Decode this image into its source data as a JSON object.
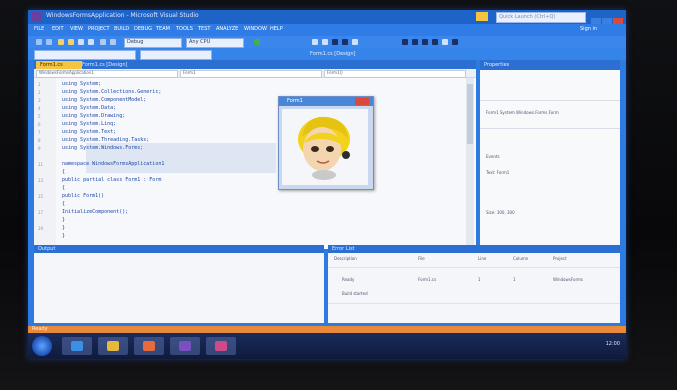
{
  "window": {
    "title": "WindowsFormsApplication - Microsoft Visual Studio",
    "quick_launch_placeholder": "Quick Launch (Ctrl+Q)",
    "user": "Sign in"
  },
  "menu": [
    "FILE",
    "EDIT",
    "VIEW",
    "PROJECT",
    "BUILD",
    "DEBUG",
    "TEAM",
    "TOOLS",
    "TEST",
    "ANALYZE",
    "WINDOW",
    "HELP"
  ],
  "toolbar": {
    "config": "Debug",
    "platform": "Any CPU",
    "secondary_label": "Form1.cs [Design]"
  },
  "editor": {
    "tabs": [
      "Form1.cs",
      "Form1.cs [Design]"
    ],
    "nav": [
      "WindowsFormsApplication1",
      "Form1",
      "Form1()"
    ],
    "lines": [
      "using System;",
      "using System.Collections.Generic;",
      "using System.ComponentModel;",
      "using System.Data;",
      "using System.Drawing;",
      "using System.Linq;",
      "using System.Text;",
      "using System.Threading.Tasks;",
      "using System.Windows.Forms;",
      "",
      "namespace WindowsFormsApplication1",
      "{",
      "    public partial class Form1 : Form",
      "    {",
      "        public Form1()",
      "        {",
      "            InitializeComponent();",
      "        }",
      "    }",
      "}"
    ]
  },
  "form_window": {
    "title": "Form1"
  },
  "properties": {
    "title": "Properties",
    "rows": [
      "Form1 System.Windows.Forms.Form",
      "Events",
      "Text: Form1",
      "Size: 300, 300"
    ]
  },
  "bottom_left": {
    "title": "Output"
  },
  "bottom_right": {
    "title": "Error List",
    "headers": [
      "Description",
      "File",
      "Line",
      "Column",
      "Project"
    ],
    "rows": [
      [
        "Ready",
        "Form1.cs",
        "1",
        "1",
        "WindowsForms"
      ],
      [
        "Build started",
        "",
        "",
        "",
        ""
      ]
    ]
  },
  "status": {
    "text": "Ready"
  },
  "taskbar": {
    "clock": "12:00"
  },
  "colors": {
    "vs_accent": "#2d7ae0",
    "tab_active": "#f5c542",
    "status_bar": "#e9893a"
  }
}
